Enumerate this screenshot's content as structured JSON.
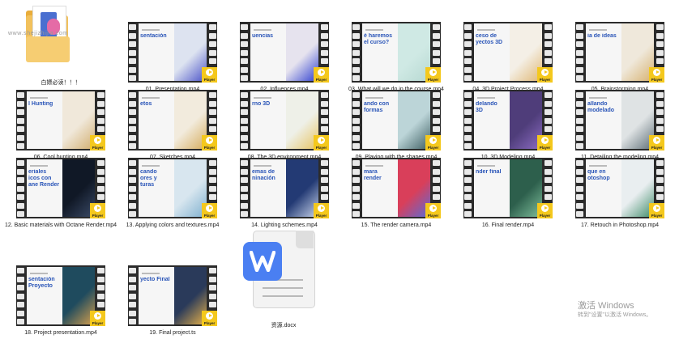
{
  "folder": {
    "label": "白嫖必读！！！",
    "watermark": "www.shejizhijia.com"
  },
  "videos": [
    {
      "label": "01. Presentation.mp4",
      "title": "sentación",
      "art": "#dde3f0",
      "accent": "#4a52c8"
    },
    {
      "label": "02. Influences.mp4",
      "title": "uencias",
      "art": "#e6e3ee",
      "accent": "#2f3fd0"
    },
    {
      "label": "03. What will we do in the course.mp4",
      "title": "é haremos\nel curso?",
      "art": "#cfe9e4",
      "accent": "#b7d9d2"
    },
    {
      "label": "04. 3D Project Process.mp4",
      "title": "ceso de\nyectos 3D",
      "art": "#f4efe6",
      "accent": "#e0b774"
    },
    {
      "label": "05. Brainstorming.mp4",
      "title": "ia de ideas",
      "art": "#efe8db",
      "accent": "#d7b16f"
    },
    {
      "label": "06. Cool hunting.mp4",
      "title": "l Hunting",
      "art": "#f0e8da",
      "accent": "#d2ae70"
    },
    {
      "label": "07. Sketches.mp4",
      "title": "etos",
      "art": "#f2ebdd",
      "accent": "#d6ad5e"
    },
    {
      "label": "08. The 3D environment.mp4",
      "title": "rno 3D",
      "art": "#eef0e8",
      "accent": "#e7c463"
    },
    {
      "label": "09. Playing with the shapes.mp4",
      "title": "ando con\nformas",
      "art": "#bcd5d8",
      "accent": "#3e5f63"
    },
    {
      "label": "10. 3D Modeling.mp4",
      "title": "delando\n3D",
      "art": "#4f3d7a",
      "accent": "#8c6cc4"
    },
    {
      "label": "11. Detailing the modeling.mp4",
      "title": "allando\nmodelado",
      "art": "#dfe3e4",
      "accent": "#5f6f78"
    },
    {
      "label": "12. Basic materials with Octane Render.mp4",
      "title": "eriales\nicos con\nane Render",
      "art": "#101826",
      "accent": "#3a4a66"
    },
    {
      "label": "13. Applying colors and textures.mp4",
      "title": "cando\nores y\nturas",
      "art": "#d8e6ef",
      "accent": "#7fb0cf"
    },
    {
      "label": "14. Lighting schemes.mp4",
      "title": "emas de\nninación",
      "art": "#233a74",
      "accent": "#c6d2ea"
    },
    {
      "label": "15. The render camera.mp4",
      "title": "mara\nrender",
      "art": "#d93f5a",
      "accent": "#5a6bd6"
    },
    {
      "label": "16. Final render.mp4",
      "title": "nder final",
      "art": "#2d5f4c",
      "accent": "#7fbf9c"
    },
    {
      "label": "17. Retouch in Photoshop.mp4",
      "title": "que en\notoshop",
      "art": "#e9eef0",
      "accent": "#3f8c6a"
    },
    {
      "label": "18. Project presentation.mp4",
      "title": "sentación\nProyecto",
      "art": "#1f4b5e",
      "accent": "#d6a04d"
    },
    {
      "label": "19. Final project.ts",
      "title": "yecto Final",
      "art": "#2a3a5a",
      "accent": "#e7b24a"
    }
  ],
  "player_badge": "Player",
  "doc": {
    "label": "资源.docx",
    "badge": "W"
  },
  "activation": {
    "title": "激活 Windows",
    "subtitle": "转到\"设置\"以激活 Windows。"
  },
  "colors": {
    "title_text": "#2a55b8",
    "badge_yellow": "#f4c81d",
    "word_blue": "#4a7ff2"
  }
}
